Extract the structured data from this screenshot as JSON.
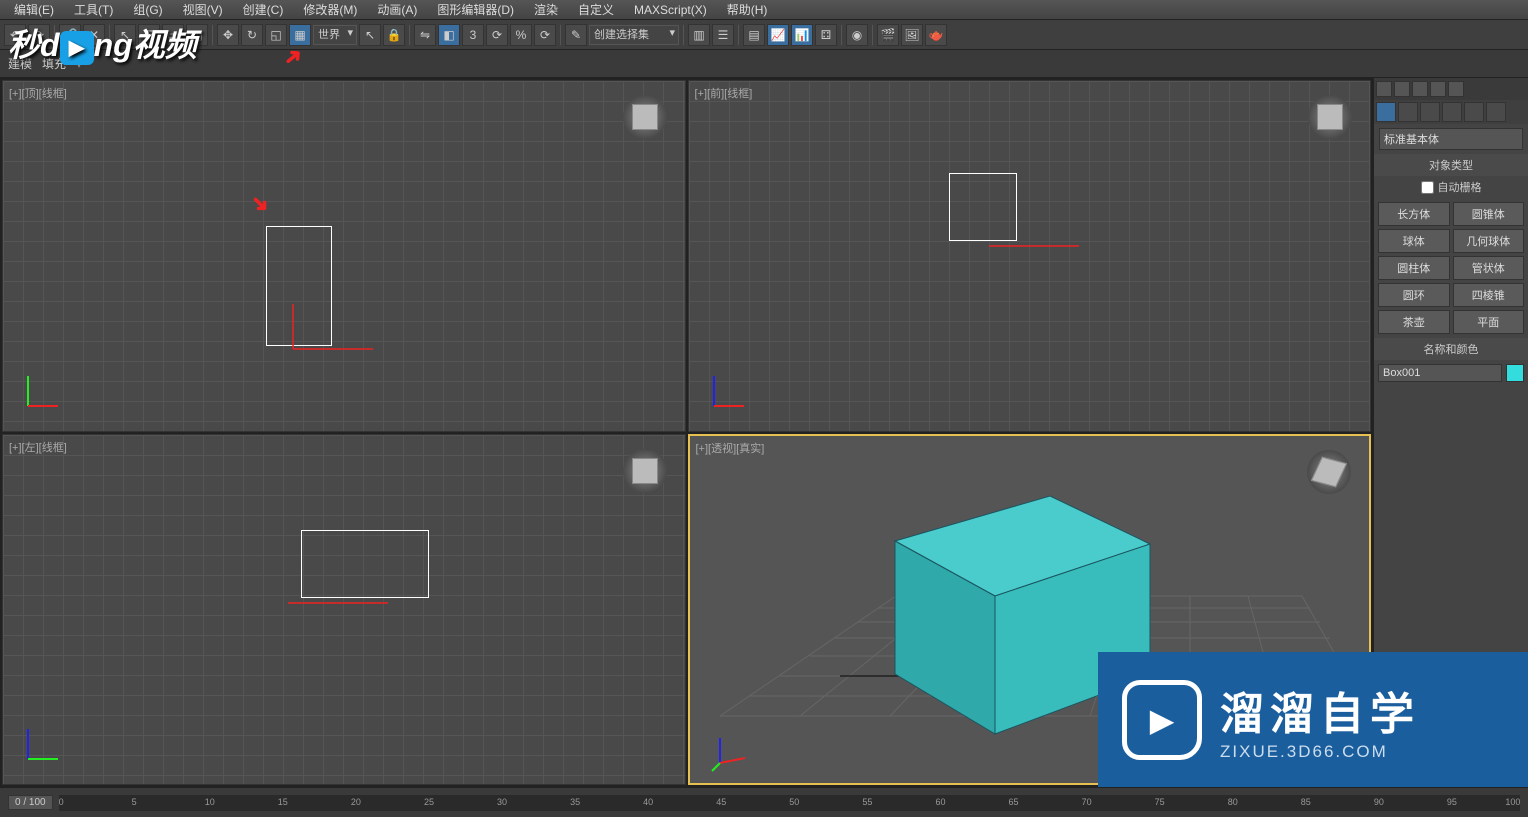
{
  "menu": [
    "编辑(E)",
    "工具(T)",
    "组(G)",
    "视图(V)",
    "创建(C)",
    "修改器(M)",
    "动画(A)",
    "图形编辑器(D)",
    "渲染",
    "自定义",
    "MAXScript(X)",
    "帮助(H)"
  ],
  "toolbar": {
    "coordSystem": "世界",
    "selectionSet": "创建选择集",
    "fillLabel": "填充",
    "angleValue": "3"
  },
  "viewports": {
    "top": "[+][顶][线框]",
    "front": "[+][前][线框]",
    "left": "[+][左][线框]",
    "persp": "[+][透视][真实]"
  },
  "commandPanel": {
    "geometryDropdown": "标准基本体",
    "objectTypeHeader": "对象类型",
    "autoGridLabel": "自动栅格",
    "primitives": [
      [
        "长方体",
        "圆锥体"
      ],
      [
        "球体",
        "几何球体"
      ],
      [
        "圆柱体",
        "管状体"
      ],
      [
        "圆环",
        "四棱锥"
      ],
      [
        "茶壶",
        "平面"
      ]
    ],
    "nameColorHeader": "名称和颜色",
    "objectName": "Box001",
    "objectColor": "#35d6d6"
  },
  "timeline": {
    "frame": "0 / 100",
    "ticks": [
      "0",
      "5",
      "10",
      "15",
      "20",
      "25",
      "30",
      "35",
      "40",
      "45",
      "50",
      "55",
      "60",
      "65",
      "70",
      "75",
      "80",
      "85",
      "90",
      "95",
      "100"
    ]
  },
  "watermarks": {
    "top": {
      "prefix": "秒d",
      "middle": "ng",
      "suffix": "视频"
    },
    "bottom": {
      "title": "溜溜自学",
      "subtitle": "ZIXUE.3D66.COM"
    }
  }
}
